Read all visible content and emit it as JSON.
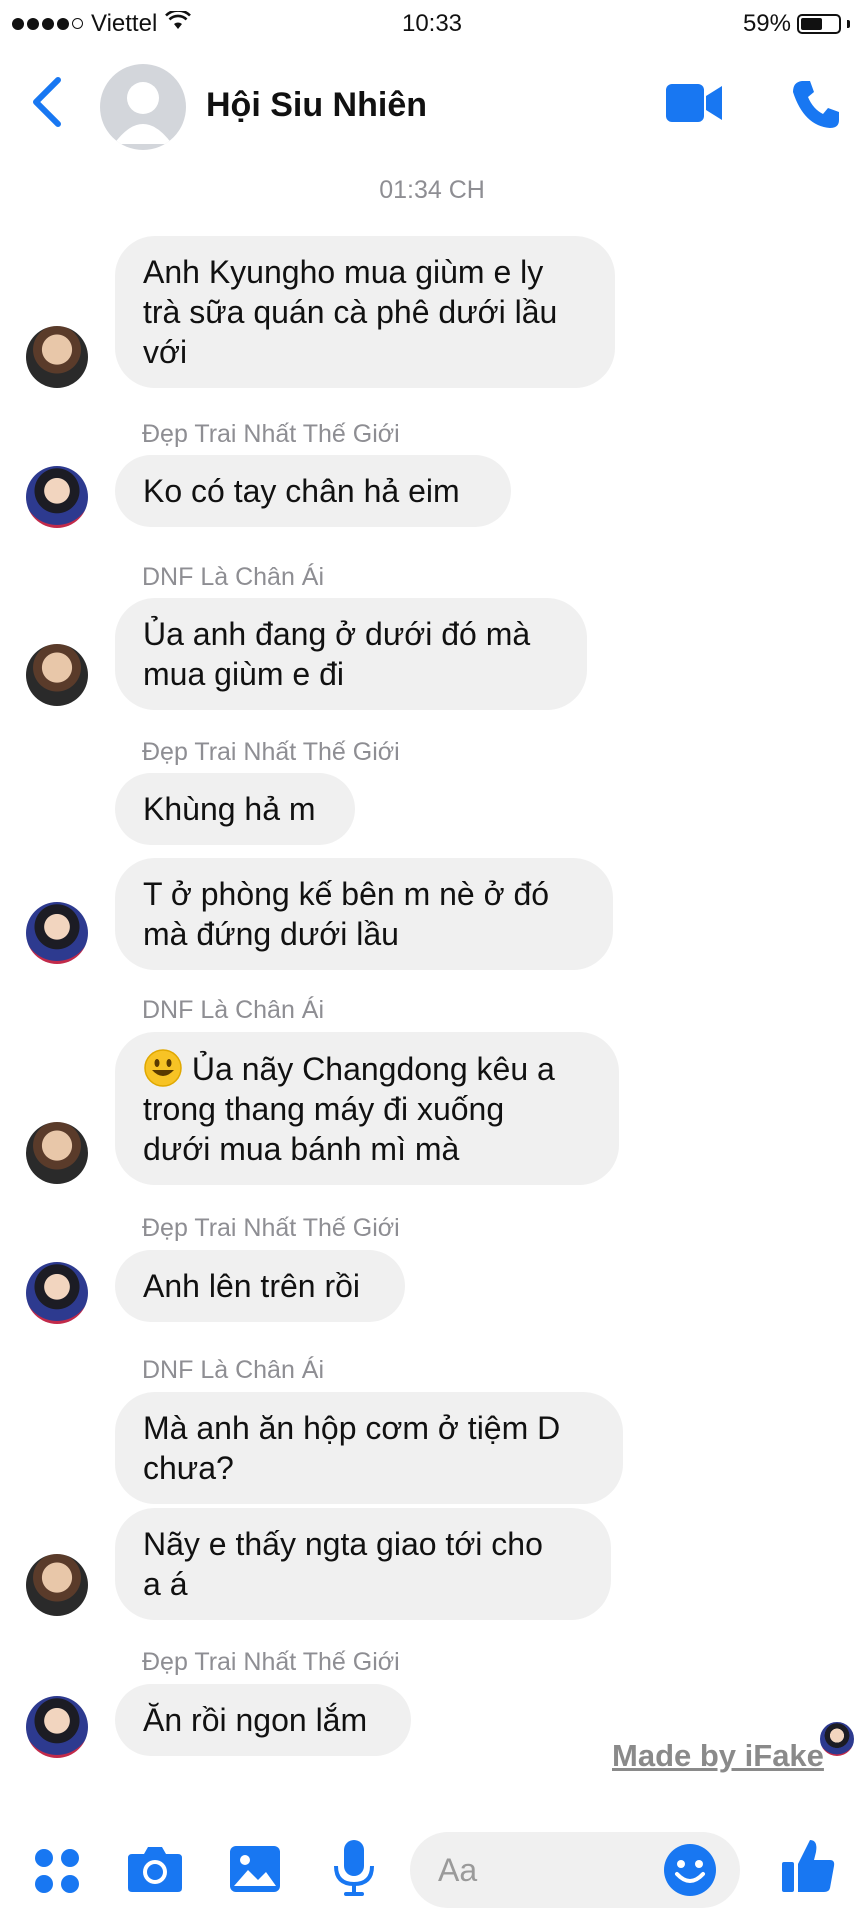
{
  "status_bar": {
    "carrier": "Viettel",
    "time": "10:33",
    "battery_percent": "59%",
    "battery_level": 0.59,
    "signal_bars": 4
  },
  "header": {
    "title": "Hội Siu Nhiên"
  },
  "timestamp": "01:34 CH",
  "messages": [
    {
      "sender": "",
      "lines": [
        "Anh Kyungho mua giùm e ly",
        "trà sữa quán cà phê dưới lầu",
        "với"
      ]
    },
    {
      "sender": "Đẹp Trai Nhất Thế Giới",
      "lines": [
        "Ko có tay chân hả eim"
      ]
    },
    {
      "sender": "DNF Là Chân Ái",
      "lines": [
        "Ủa anh đang ở dưới đó mà",
        "mua giùm e đi"
      ]
    },
    {
      "sender": "Đẹp Trai Nhất Thế Giới",
      "lines": [
        "Khùng hả m"
      ]
    },
    {
      "sender": "",
      "lines": [
        "T ở phòng kế bên m nè ở đó",
        "mà đứng dưới lầu"
      ]
    },
    {
      "sender": "DNF Là Chân Ái",
      "lines": [
        "Ủa nãy Changdong kêu a",
        "trong thang máy đi xuống",
        "dưới mua bánh mì mà"
      ]
    },
    {
      "sender": "Đẹp Trai Nhất Thế Giới",
      "lines": [
        "Anh lên trên rồi"
      ]
    },
    {
      "sender": "DNF Là Chân Ái",
      "lines": [
        "Mà anh ăn hộp cơm ở tiệm D",
        "chưa?"
      ]
    },
    {
      "sender": "",
      "lines": [
        "Nãy e thấy ngta giao tới cho",
        "a á"
      ]
    },
    {
      "sender": "Đẹp Trai Nhất Thế Giới",
      "lines": [
        "Ăn rồi ngon lắm"
      ]
    }
  ],
  "watermark": "Made by iFake",
  "composer": {
    "placeholder": "Aa"
  },
  "colors": {
    "accent": "#1877f2",
    "bubble": "#f0f0f0",
    "meta_text": "#8e8e93"
  }
}
